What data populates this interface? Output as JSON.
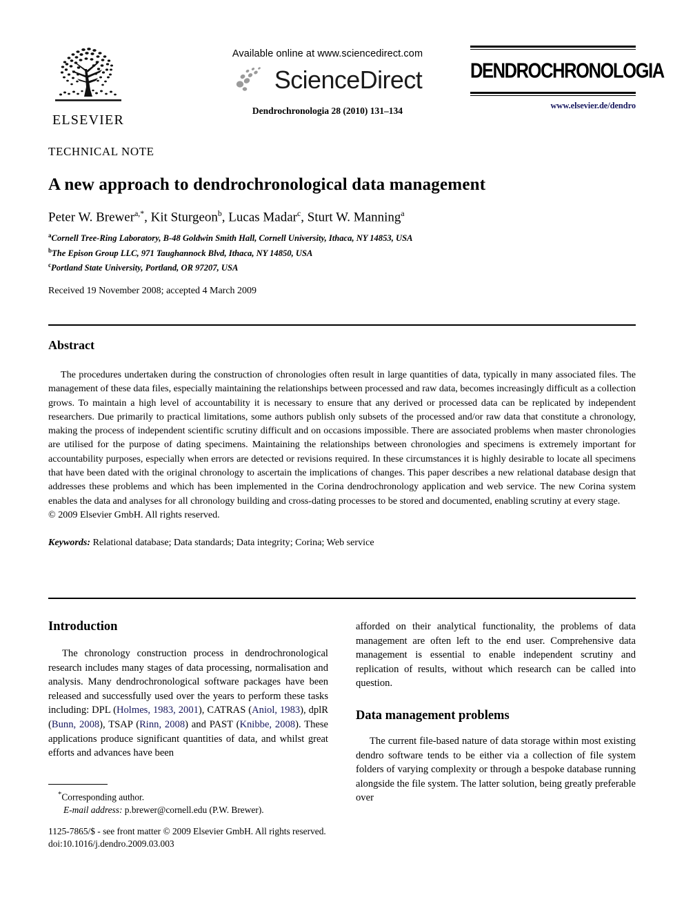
{
  "header": {
    "elsevier": {
      "wordmark": "ELSEVIER",
      "tree_icon": "elsevier-tree-icon"
    },
    "sciencedirect": {
      "available_line": "Available online at www.sciencedirect.com",
      "wordmark": "ScienceDirect",
      "swoosh_icon": "sciencedirect-swoosh-icon",
      "citation_line": "Dendrochronologia 28 (2010) 131–134"
    },
    "masthead": {
      "journal_title": "DENDROCHRONOLOGIA",
      "url": "www.elsevier.de/dendro",
      "url_color": "#16175e"
    }
  },
  "article": {
    "category": "TECHNICAL NOTE",
    "title": "A new approach to dendrochronological data management",
    "authors": [
      {
        "name": "Peter W. Brewer",
        "marks": "a,*"
      },
      {
        "name": "Kit Sturgeon",
        "marks": "b"
      },
      {
        "name": "Lucas Madar",
        "marks": "c"
      },
      {
        "name": "Sturt W. Manning",
        "marks": "a"
      }
    ],
    "affiliations": [
      {
        "mark": "a",
        "text": "Cornell Tree-Ring Laboratory, B-48 Goldwin Smith Hall, Cornell University, Ithaca, NY 14853, USA"
      },
      {
        "mark": "b",
        "text": "The Epison Group LLC, 971 Taughannock Blvd, Ithaca, NY 14850, USA"
      },
      {
        "mark": "c",
        "text": "Portland State University, Portland, OR 97207, USA"
      }
    ],
    "history": "Received 19 November 2008; accepted 4 March 2009"
  },
  "abstract": {
    "heading": "Abstract",
    "text": "The procedures undertaken during the construction of chronologies often result in large quantities of data, typically in many associated files. The management of these data files, especially maintaining the relationships between processed and raw data, becomes increasingly difficult as a collection grows. To maintain a high level of accountability it is necessary to ensure that any derived or processed data can be replicated by independent researchers. Due primarily to practical limitations, some authors publish only subsets of the processed and/or raw data that constitute a chronology, making the process of independent scientific scrutiny difficult and on occasions impossible. There are associated problems when master chronologies are utilised for the purpose of dating specimens. Maintaining the relationships between chronologies and specimens is extremely important for accountability purposes, especially when errors are detected or revisions required. In these circumstances it is highly desirable to locate all specimens that have been dated with the original chronology to ascertain the implications of changes. This paper describes a new relational database design that addresses these problems and which has been implemented in the Corina dendrochronology application and web service. The new Corina system enables the data and analyses for all chronology building and cross-dating processes to be stored and documented, enabling scrutiny at every stage.",
    "copyright": "© 2009 Elsevier GmbH. All rights reserved.",
    "keywords_label": "Keywords:",
    "keywords_value": "Relational database; Data standards; Data integrity; Corina; Web service"
  },
  "body": {
    "left_column": {
      "section_heading": "Introduction",
      "paragraph_part1": "The chronology construction process in dendrochronological research includes many stages of data processing, normalisation and analysis. Many dendrochronological software packages have been released and successfully used over the years to perform these tasks including: DPL (",
      "cite1": "Holmes, 1983, 2001",
      "between1": "), CATRAS (",
      "cite2": "Aniol, 1983",
      "between2": "), dplR (",
      "cite3": "Bunn, 2008",
      "between3": "), TSAP (",
      "cite4": "Rinn, 2008",
      "between4": ") and PAST (",
      "cite5": "Knibbe, 2008",
      "paragraph_part2": "). These applications produce significant quantities of data, and whilst great efforts and advances have been"
    },
    "right_column": {
      "continued_paragraph": "afforded on their analytical functionality, the problems of data management are often left to the end user. Comprehensive data management is essential to enable independent scrutiny and replication of results, without which research can be called into question.",
      "section_heading": "Data management problems",
      "paragraph": "The current file-based nature of data storage within most existing dendro software tends to be either via a collection of file system folders of varying complexity or through a bespoke database running alongside the file system. The latter solution, being greatly preferable over"
    }
  },
  "footnotes": {
    "corresponding_mark": "*",
    "corresponding_text": "Corresponding author.",
    "email_label": "E-mail address:",
    "email_value": "p.brewer@cornell.edu (P.W. Brewer)."
  },
  "imprint": {
    "line1": "1125-7865/$ - see front matter © 2009 Elsevier GmbH. All rights reserved.",
    "line2": "doi:10.1016/j.dendro.2009.03.003"
  }
}
